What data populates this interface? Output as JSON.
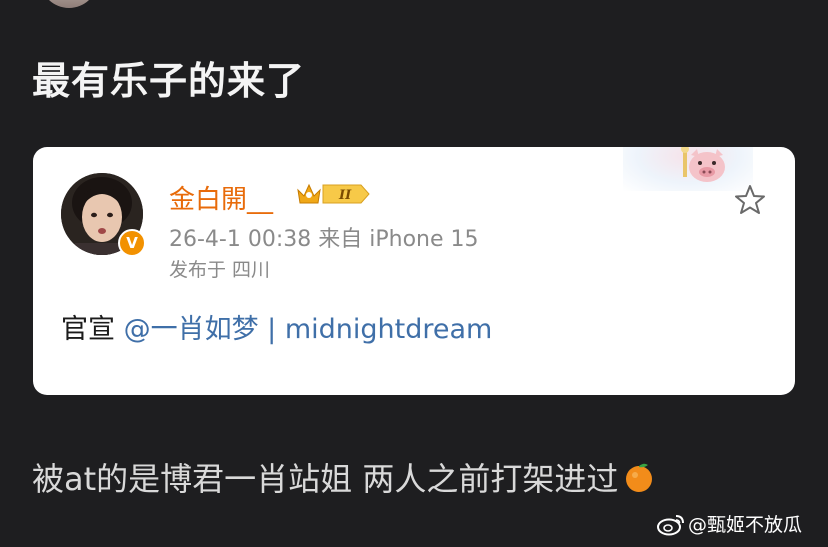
{
  "post": {
    "title": "最有乐子的来了",
    "comment": "被at的是博君一肖站姐 两人之前打架进过",
    "comment_emoji": "orange-emoji"
  },
  "quoted": {
    "username": "金白開__",
    "badge": "II",
    "time": "26-4-1 00:38",
    "source": "来自 iPhone 15",
    "location": "发布于 四川",
    "body_prefix": "官宣 ",
    "mention": "@一肖如梦",
    "body_suffix": " | midnightdream",
    "verified_mark": "V"
  },
  "watermark": {
    "text": "@甄姬不放瓜",
    "icon": "weibo-icon"
  },
  "colors": {
    "background": "#1e1e20",
    "card": "#ffffff",
    "username": "#e86b0a",
    "mention": "#3f6fa8",
    "meta": "#8a8a8a",
    "verified": "#f29100"
  }
}
